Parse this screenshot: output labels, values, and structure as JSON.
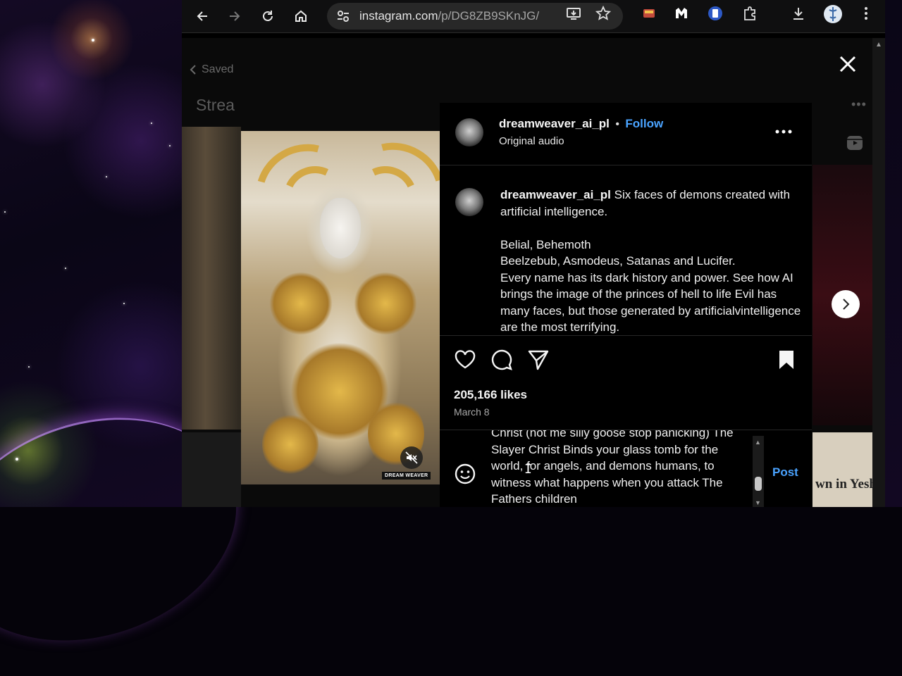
{
  "browser": {
    "url_host": "instagram.com",
    "url_path": "/p/DG8ZB9SKnJG/"
  },
  "background_page": {
    "back_label": "Saved",
    "title": "Strea",
    "right_doc_text": "wn in Yeshug"
  },
  "post": {
    "username": "dreamweaver_ai_pl",
    "separator": "•",
    "follow_label": "Follow",
    "audio_label": "Original audio",
    "watermark": "DREAM WEAVER",
    "caption_user": "dreamweaver_ai_pl",
    "caption_line1": " Six faces of demons created with artificial intelligence.",
    "caption_line2": "Belial, Behemoth",
    "caption_line3": "Beelzebub, Asmodeus, Satanas and Lucifer.",
    "caption_line4": "Every name has its dark history and power. See how AI brings the image of the princes of hell to life Evil has many faces, but those generated by artificialvintelligence are the most terrifying.",
    "likes": "205,166 likes",
    "date": "March 8"
  },
  "comment": {
    "text": "Christ (not me silly goose stop panicking) The Slayer Christ Binds your glass tomb for the world, for angels, and demons humans, to witness what happens when you attack The Fathers children",
    "post_label": "Post"
  }
}
